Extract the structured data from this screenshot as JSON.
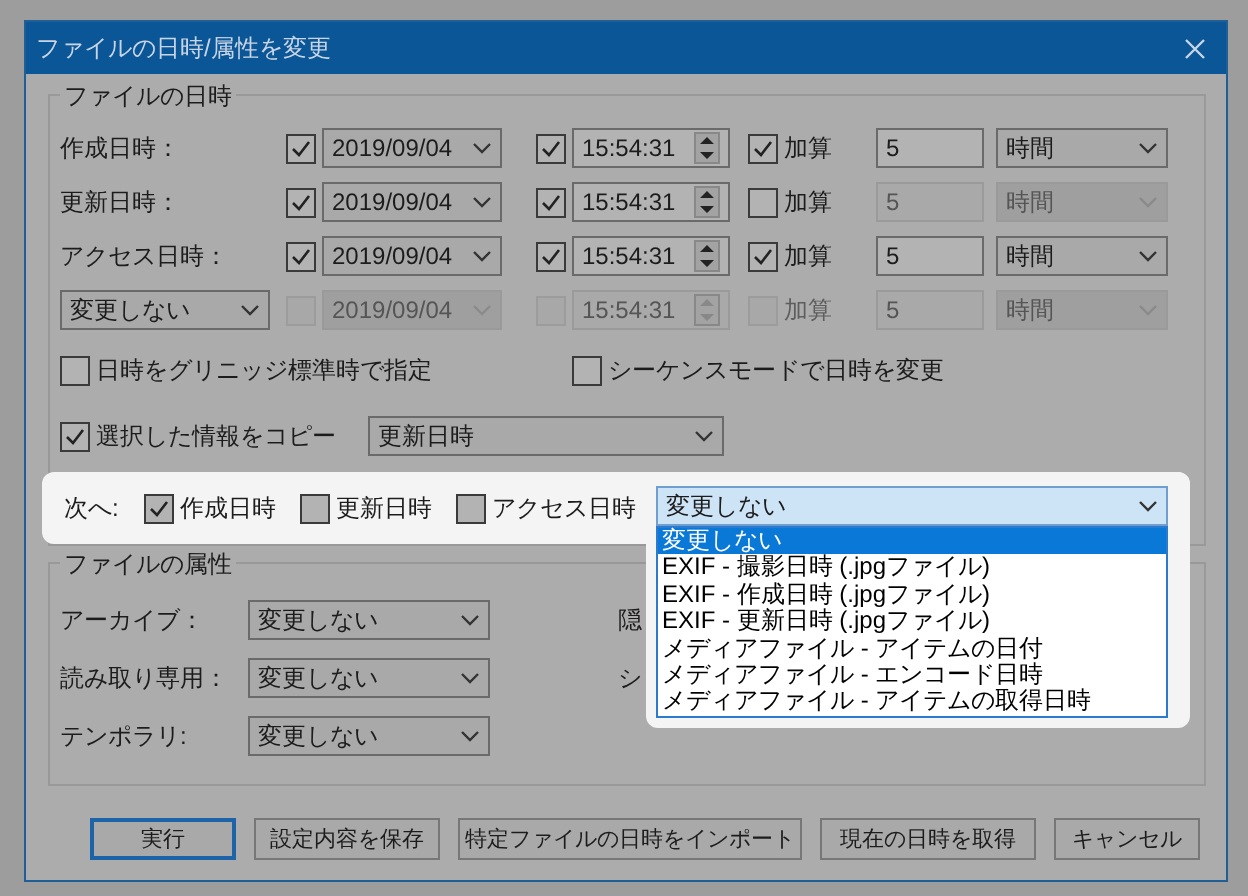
{
  "window": {
    "title": "ファイルの日時/属性を変更"
  },
  "datetime": {
    "title": "ファイルの日時",
    "rows": [
      {
        "kind": "label",
        "label": "作成日時：",
        "disabled": false,
        "date_checked": true,
        "date": "2019/09/04",
        "time_checked": true,
        "time": "15:54:31",
        "add_checked": true,
        "add_label": "加算",
        "amount": "5",
        "unit": "時間"
      },
      {
        "kind": "label",
        "label": "更新日時：",
        "disabled": false,
        "date_checked": true,
        "date": "2019/09/04",
        "time_checked": true,
        "time": "15:54:31",
        "add_checked": false,
        "add_label": "加算",
        "amount": "5",
        "unit": "時間"
      },
      {
        "kind": "label",
        "label": "アクセス日時：",
        "disabled": false,
        "date_checked": true,
        "date": "2019/09/04",
        "time_checked": true,
        "time": "15:54:31",
        "add_checked": true,
        "add_label": "加算",
        "amount": "5",
        "unit": "時間"
      },
      {
        "kind": "selector",
        "label": "変更しない",
        "disabled": true,
        "date_checked": false,
        "date": "2019/09/04",
        "time_checked": false,
        "time": "15:54:31",
        "add_checked": false,
        "add_label": "加算",
        "amount": "5",
        "unit": "時間"
      }
    ],
    "options": [
      {
        "label": "日時をグリニッジ標準時で指定",
        "checked": false
      },
      {
        "label": "シーケンスモードで日時を変更",
        "checked": false
      }
    ],
    "copy": {
      "label": "選択した情報をコピー",
      "checked": true,
      "source": "更新日時"
    },
    "next": {
      "label": "次へ:",
      "targets": [
        {
          "label": "作成日時",
          "checked": true
        },
        {
          "label": "更新日時",
          "checked": false
        },
        {
          "label": "アクセス日時",
          "checked": false
        }
      ],
      "value": "変更しない",
      "options": [
        {
          "label": "変更しない",
          "selected": true
        },
        {
          "label": "EXIF - 撮影日時 (.jpgファイル)",
          "selected": false
        },
        {
          "label": "EXIF - 作成日時 (.jpgファイル)",
          "selected": false
        },
        {
          "label": "EXIF - 更新日時 (.jpgファイル)",
          "selected": false
        },
        {
          "label": "メディアファイル - アイテムの日付",
          "selected": false
        },
        {
          "label": "メディアファイル - エンコード日時",
          "selected": false
        },
        {
          "label": "メディアファイル - アイテムの取得日時",
          "selected": false
        }
      ]
    }
  },
  "attributes": {
    "title": "ファイルの属性",
    "items": [
      {
        "label": "アーカイブ：",
        "value": "変更しない",
        "side_label": "隠"
      },
      {
        "label": "読み取り専用：",
        "value": "変更しない",
        "side_label": "シ"
      },
      {
        "label": "テンポラリ:",
        "value": "変更しない"
      }
    ]
  },
  "buttons": [
    {
      "label": "実行",
      "default": true
    },
    {
      "label": "設定内容を保存",
      "default": false
    },
    {
      "label": "特定ファイルの日時をインポート",
      "default": false
    },
    {
      "label": "現在の日時を取得",
      "default": false
    },
    {
      "label": "キャンセル",
      "default": false
    }
  ]
}
